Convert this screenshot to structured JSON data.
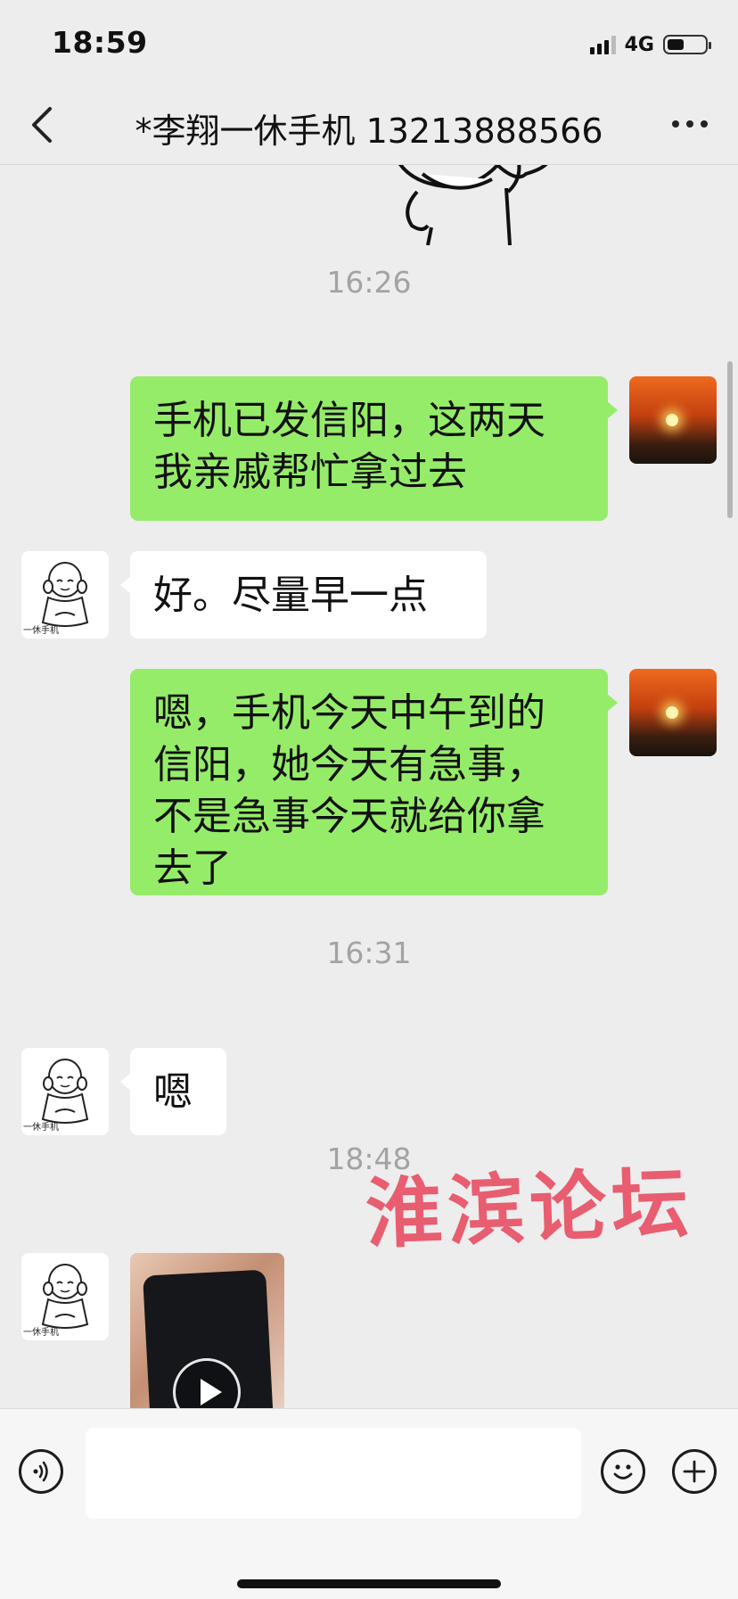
{
  "status_bar": {
    "time": "18:59",
    "network": "4G",
    "battery_level": 0.45
  },
  "header": {
    "title": "*李翔一休手机 13213888566",
    "back_icon": "chevron-left-icon",
    "more_icon": "ellipsis-icon"
  },
  "messages": [
    {
      "kind": "timestamp",
      "text": "16:26"
    },
    {
      "kind": "outgoing",
      "text": "手机已发信阳，这两天\n我亲戚帮忙拿过去"
    },
    {
      "kind": "incoming",
      "text": "好。尽量早一点"
    },
    {
      "kind": "outgoing",
      "text": "嗯，手机今天中午到的\n信阳，她今天有急事，\n不是急事今天就给你拿\n去了"
    },
    {
      "kind": "timestamp",
      "text": "16:31"
    },
    {
      "kind": "incoming",
      "text": "嗯"
    },
    {
      "kind": "timestamp",
      "text": "18:48"
    },
    {
      "kind": "incoming-video",
      "icon": "play-icon"
    }
  ],
  "avatars": {
    "self": "sunset-avatar",
    "other": {
      "image": "monk-cartoon-avatar",
      "caption": "一休手机"
    }
  },
  "watermark": "淮滨论坛",
  "input_bar": {
    "voice_icon": "voice-icon",
    "emoji_icon": "smiley-icon",
    "plus_icon": "plus-icon",
    "placeholder": ""
  },
  "colors": {
    "background": "#ededed",
    "outgoing_bubble": "#95ec69",
    "incoming_bubble": "#ffffff",
    "watermark": "#e84a5f"
  }
}
